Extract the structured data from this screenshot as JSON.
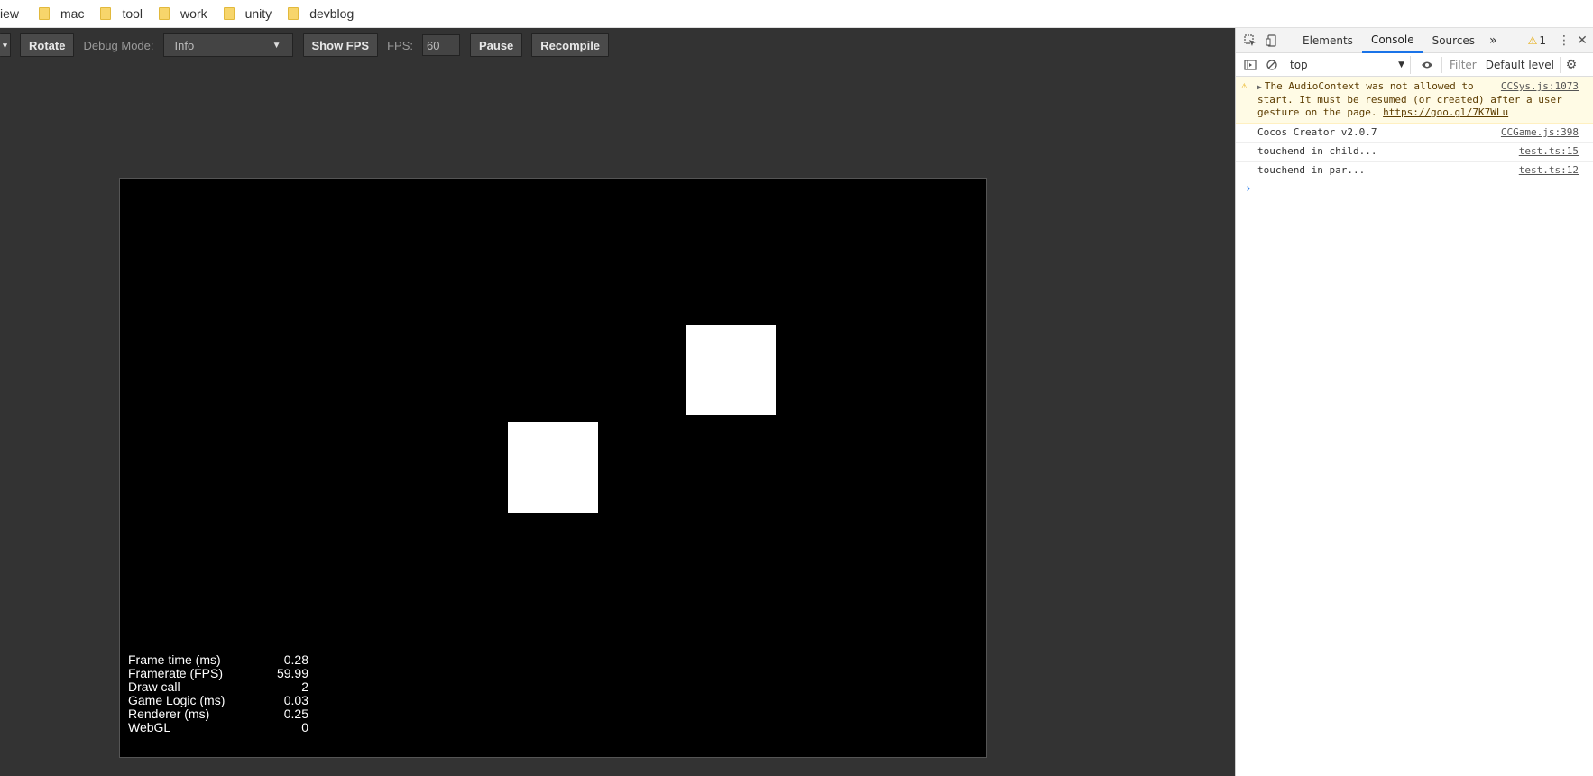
{
  "bookmarks": {
    "partial_first": "iew",
    "items": [
      "mac",
      "tool",
      "work",
      "unity",
      "devblog"
    ]
  },
  "toolbar": {
    "rotate": "Rotate",
    "debug_mode_label": "Debug Mode:",
    "debug_mode_value": "Info",
    "show_fps": "Show FPS",
    "fps_label": "FPS:",
    "fps_value": "60",
    "pause": "Pause",
    "recompile": "Recompile"
  },
  "stats": [
    {
      "label": "Frame time (ms)",
      "value": "0.28"
    },
    {
      "label": "Framerate (FPS)",
      "value": "59.99"
    },
    {
      "label": "Draw call",
      "value": "2"
    },
    {
      "label": "Game Logic (ms)",
      "value": "0.03"
    },
    {
      "label": "Renderer (ms)",
      "value": "0.25"
    },
    {
      "label": "WebGL",
      "value": "0"
    }
  ],
  "devtools": {
    "tabs": [
      "Elements",
      "Console",
      "Sources"
    ],
    "active_tab": "Console",
    "more_tabs": "»",
    "warning_count": "1",
    "context": "top",
    "filter_placeholder": "Filter",
    "log_level": "Default level",
    "messages": [
      {
        "type": "warning",
        "text": "The AudioContext was not allowed to start. It must be resumed (or created) after a user gesture on the page.",
        "link": "https://goo.gl/7K7WLu",
        "source": "CCSys.js:1073"
      },
      {
        "type": "log",
        "text": "Cocos Creator v2.0.7",
        "source": "CCGame.js:398"
      },
      {
        "type": "log",
        "text": "touchend in child...",
        "source": "test.ts:15"
      },
      {
        "type": "log",
        "text": "touchend in par...",
        "source": "test.ts:12"
      }
    ],
    "prompt": "›"
  },
  "colors": {
    "page_bg": "#333333",
    "canvas_bg": "#000000",
    "accent": "#1a73e8",
    "warning_bg": "#fffbe5"
  }
}
